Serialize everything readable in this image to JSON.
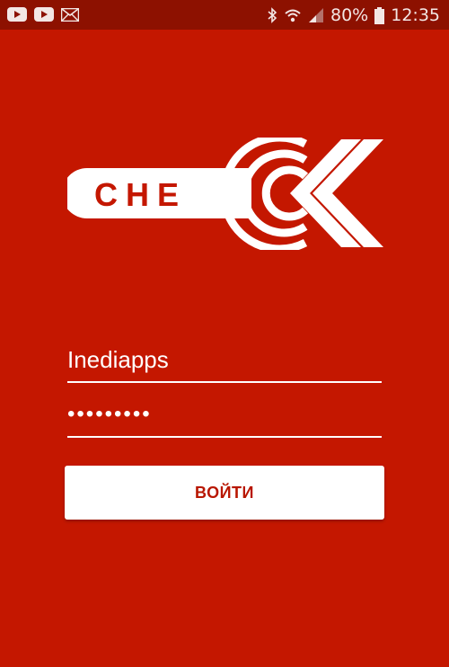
{
  "status_bar": {
    "battery_percent": "80%",
    "time": "12:35",
    "left_icons": [
      "youtube-icon",
      "youtube-icon",
      "mail-icon"
    ],
    "right_icons": [
      "bluetooth-icon",
      "wifi-icon",
      "signal-icon",
      "battery-icon"
    ]
  },
  "logo": {
    "text": "CHE",
    "brand": "CHECK"
  },
  "login_form": {
    "username_value": "Inediapps",
    "password_value": "•••••••••",
    "submit_label": "ВОЙТИ"
  },
  "colors": {
    "background": "#c41700",
    "status_bar": "#8d1100",
    "button_text": "#b81600",
    "white": "#ffffff"
  }
}
